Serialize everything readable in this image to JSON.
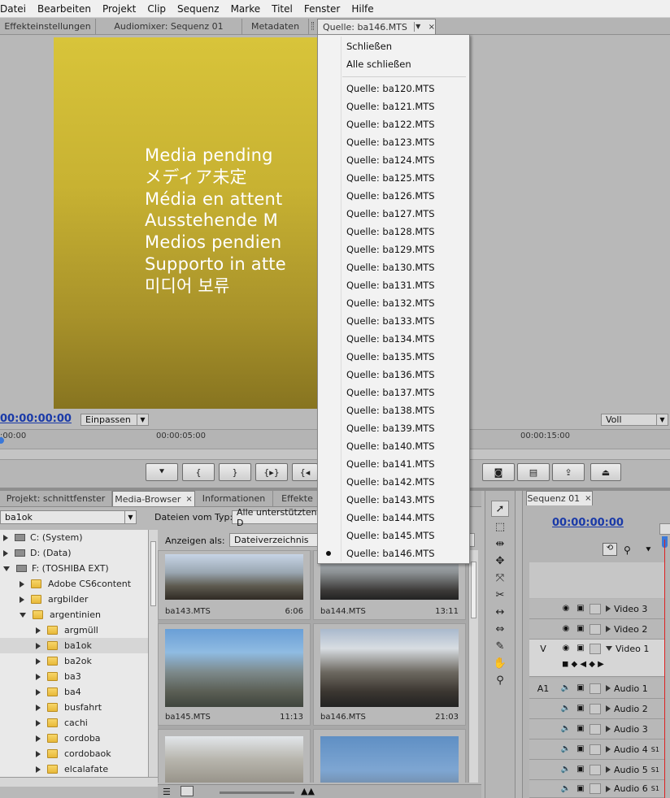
{
  "menubar": {
    "items": [
      "Datei",
      "Bearbeiten",
      "Projekt",
      "Clip",
      "Sequenz",
      "Marke",
      "Titel",
      "Fenster",
      "Hilfe"
    ]
  },
  "panel_tabs": {
    "effects": "Effekteinstellungen",
    "audiomixer": "Audiomixer: Sequenz 01",
    "metadata": "Metadaten",
    "source": "Quelle: ba146.MTS"
  },
  "monitor": {
    "pending_lines": [
      "Media pending",
      "メディア未定",
      "Média en attent",
      "Ausstehende M",
      "Medios pendien",
      "Supporto in atte",
      "미디어 보류"
    ],
    "timecode": "00:00:00:00",
    "fit_label": "Einpassen",
    "quality_label": "Voll",
    "ruler_labels": [
      ":00:00",
      "00:00:05:00",
      "00:00:15:00"
    ]
  },
  "source_menu": {
    "close": "Schließen",
    "close_all": "Alle schließen",
    "clips": [
      "Quelle: ba120.MTS",
      "Quelle: ba121.MTS",
      "Quelle: ba122.MTS",
      "Quelle: ba123.MTS",
      "Quelle: ba124.MTS",
      "Quelle: ba125.MTS",
      "Quelle: ba126.MTS",
      "Quelle: ba127.MTS",
      "Quelle: ba128.MTS",
      "Quelle: ba129.MTS",
      "Quelle: ba130.MTS",
      "Quelle: ba131.MTS",
      "Quelle: ba132.MTS",
      "Quelle: ba133.MTS",
      "Quelle: ba134.MTS",
      "Quelle: ba135.MTS",
      "Quelle: ba136.MTS",
      "Quelle: ba137.MTS",
      "Quelle: ba138.MTS",
      "Quelle: ba139.MTS",
      "Quelle: ba140.MTS",
      "Quelle: ba141.MTS",
      "Quelle: ba142.MTS",
      "Quelle: ba143.MTS",
      "Quelle: ba144.MTS",
      "Quelle: ba145.MTS",
      "Quelle: ba146.MTS"
    ],
    "selected": "Quelle: ba146.MTS"
  },
  "project_tabs": {
    "project": "Projekt: schnittfenster",
    "media_browser": "Media-Browser",
    "info": "Informationen",
    "effects": "Effekte"
  },
  "browser": {
    "path": "ba1ok",
    "file_type_label": "Dateien vom Typ:",
    "file_type_value": "Alle unterstützten D",
    "view_as_label": "Anzeigen als:",
    "view_as_value": "Dateiverzeichnis",
    "drives": [
      "C: (System)",
      "D: (Data)",
      "F: (TOSHIBA EXT)"
    ],
    "folders_level1": [
      "Adobe CS6content",
      "argbilder",
      "argentinien"
    ],
    "folders_level2": [
      "argmüll",
      "ba1ok",
      "ba2ok",
      "ba3",
      "ba4",
      "busfahrt",
      "cachi",
      "cordoba",
      "cordobaok",
      "elcalafate"
    ],
    "thumbnails": [
      {
        "name": "ba143.MTS",
        "duration": "6:06"
      },
      {
        "name": "ba144.MTS",
        "duration": "13:11"
      },
      {
        "name": "ba145.MTS",
        "duration": "11:13"
      },
      {
        "name": "ba146.MTS",
        "duration": "21:03"
      }
    ]
  },
  "sequence": {
    "tab": "Sequenz 01",
    "timecode": "00:00:00:00",
    "v_label": "V",
    "a1_label": "A1",
    "tracks": [
      "Video 3",
      "Video 2",
      "Video 1",
      "Audio 1",
      "Audio 2",
      "Audio 3",
      "Audio 4",
      "Audio 5",
      "Audio 6"
    ],
    "s1_label": "S1"
  }
}
